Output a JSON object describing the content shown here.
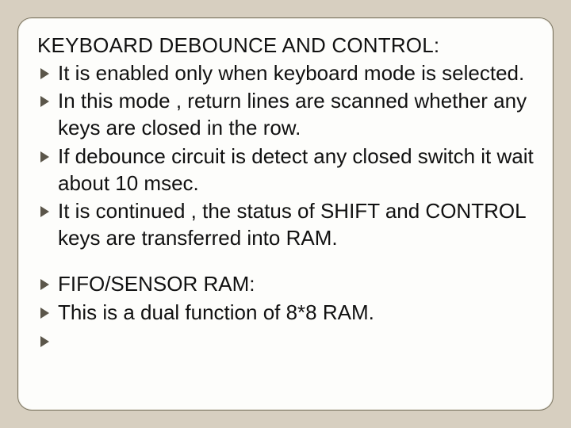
{
  "slide": {
    "heading": "KEYBOARD DEBOUNCE AND CONTROL:",
    "group1": [
      "It is enabled only when keyboard mode is selected.",
      "In this mode , return lines are scanned whether any keys are closed in the row.",
      "If debounce circuit is detect any closed switch it wait about 10 msec.",
      "It is continued , the status of SHIFT and CONTROL keys are transferred into RAM."
    ],
    "group2": [
      "FIFO/SENSOR RAM:",
      "This is a dual function of 8*8 RAM.",
      ""
    ]
  }
}
